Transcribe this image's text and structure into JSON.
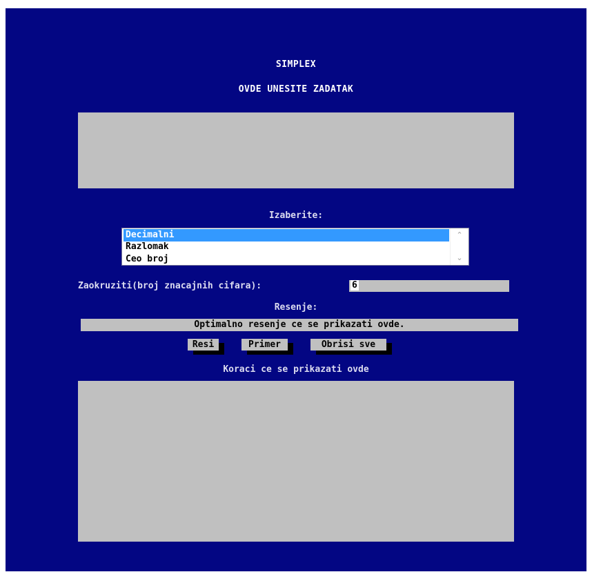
{
  "header": {
    "title": "SIMPLEX",
    "subtitle": "OVDE UNESITE ZADATAK"
  },
  "task_input": {
    "value": ""
  },
  "choose": {
    "label": "Izaberite:",
    "options": [
      "Decimalni",
      "Razlomak",
      "Ceo broj"
    ],
    "selected": "Decimalni"
  },
  "rounding": {
    "label": "Zaokruziti(broj znacajnih cifara):",
    "value": "6"
  },
  "result": {
    "label": "Resenje:",
    "text": "Optimalno resenje ce se prikazati ovde."
  },
  "buttons": {
    "solve": "Resi",
    "example": "Primer",
    "clear": "Obrisi sve"
  },
  "steps": {
    "label": "Koraci ce se prikazati ovde",
    "value": ""
  },
  "colors": {
    "background": "#030683",
    "panel": "#c0c0c0",
    "selection": "#3399ff"
  },
  "icons": {
    "scroll_up": "chevron-up-icon",
    "scroll_down": "chevron-down-icon"
  }
}
